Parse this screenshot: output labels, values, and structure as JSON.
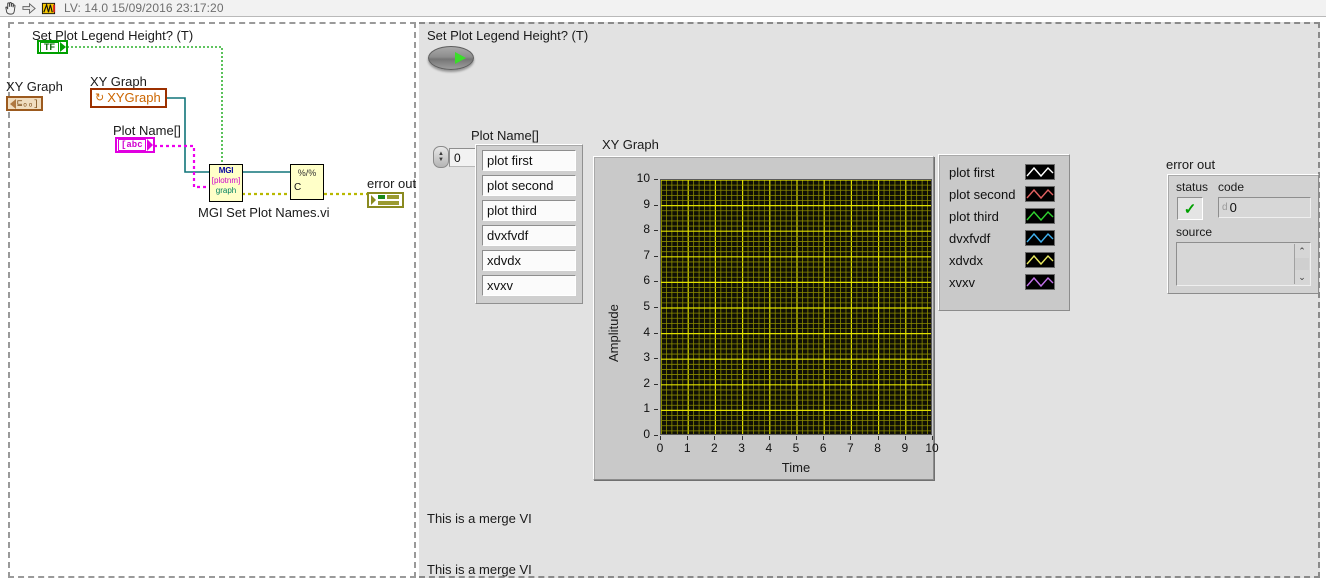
{
  "titlebar": {
    "icons": [
      "hand-cursor-icon",
      "arrow-icon",
      "labview-icon"
    ],
    "title": "LV: 14.0 15/09/2016 23:17:20"
  },
  "block_diagram": {
    "boolean": {
      "label": "Set Plot Legend Height? (T)",
      "terminal_text": "TF"
    },
    "xy_graph_indicator": {
      "label": "XY Graph",
      "terminal_text": "⊑ₒₒ]"
    },
    "xy_graph_control": {
      "label": "XY Graph",
      "value": "XYGraph"
    },
    "plot_names": {
      "label": "Plot Name[]",
      "terminal_text": "[abc"
    },
    "subvi": {
      "caption": "MGI Set Plot Names.vi",
      "line1": "MGI",
      "line2": "[plotnm]",
      "line3": "graph"
    },
    "conversion_node": {
      "line1": "%/%",
      "line2": "C"
    },
    "error_out": {
      "label": "error out"
    }
  },
  "front_panel": {
    "switch": {
      "label": "Set Plot Legend Height? (T)",
      "state": "on"
    },
    "array": {
      "label": "Plot Name[]",
      "index": "0",
      "items": [
        "plot first",
        "plot second",
        "plot third",
        "dvxfvdf",
        "xdvdx",
        "xvxv"
      ]
    },
    "graph": {
      "title": "XY Graph"
    },
    "legend": {
      "entries": [
        {
          "name": "plot first",
          "color": "#ffffff"
        },
        {
          "name": "plot second",
          "color": "#e06060"
        },
        {
          "name": "plot third",
          "color": "#30d030"
        },
        {
          "name": "dvxfvdf",
          "color": "#40b0ee"
        },
        {
          "name": "xdvdx",
          "color": "#e8e860"
        },
        {
          "name": "xvxv",
          "color": "#c070e8"
        }
      ]
    },
    "error_out": {
      "label": "error out",
      "status_label": "status",
      "status_value": "✓",
      "code_label": "code",
      "code_prefix": "d",
      "code_value": "0",
      "source_label": "source",
      "source_value": "",
      "scroll_up": "⌃",
      "scroll_down": "⌄"
    },
    "notes": [
      "This is a merge VI",
      "This is a merge VI"
    ]
  },
  "chart_data": {
    "type": "scatter",
    "title": "XY Graph",
    "xlabel": "Time",
    "ylabel": "Amplitude",
    "xlim": [
      0,
      10
    ],
    "ylim": [
      0,
      10
    ],
    "xticks": [
      0,
      1,
      2,
      3,
      4,
      5,
      6,
      7,
      8,
      9,
      10
    ],
    "yticks": [
      0,
      1,
      2,
      3,
      4,
      5,
      6,
      7,
      8,
      9,
      10
    ],
    "grid": true,
    "grid_color": "#c8c800",
    "plot_background": "#101005",
    "legend_position": "right-outside",
    "series": [
      {
        "name": "plot first",
        "color": "#ffffff",
        "x": [],
        "y": []
      },
      {
        "name": "plot second",
        "color": "#e06060",
        "x": [],
        "y": []
      },
      {
        "name": "plot third",
        "color": "#30d030",
        "x": [],
        "y": []
      },
      {
        "name": "dvxfvdf",
        "color": "#40b0ee",
        "x": [],
        "y": []
      },
      {
        "name": "xdvdx",
        "color": "#e8e860",
        "x": [],
        "y": []
      },
      {
        "name": "xvxv",
        "color": "#c070e8",
        "x": [],
        "y": []
      }
    ]
  }
}
